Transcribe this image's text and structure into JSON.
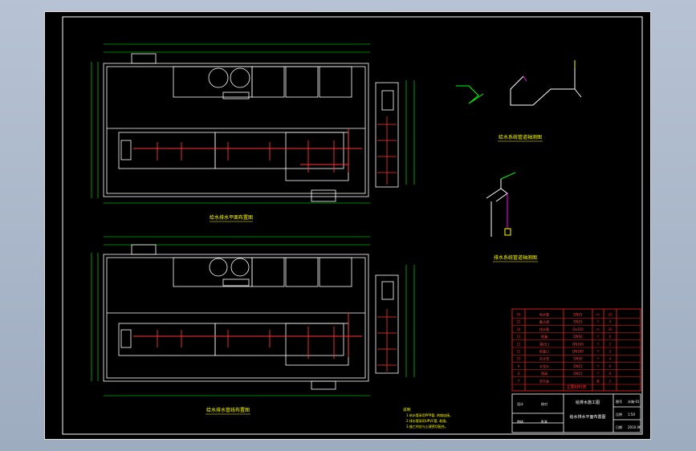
{
  "drawing": {
    "plan_top_title": "给水排水平面布置图",
    "plan_bottom_title": "给水排水管线布置图",
    "iso_supply_title": "给水系统管道轴测图",
    "iso_drain_title": "排水系统管道轴测图",
    "notes_heading": "说明:",
    "notes": [
      "1.给水管采用PPR管, 热熔连接。",
      "2.排水管采用UPVC管, 粘接。",
      "3.施工时应与土建密切配合。"
    ]
  },
  "legend_table": {
    "rows": [
      {
        "no": "16",
        "name": "给水管",
        "spec": "DN25",
        "unit": "m",
        "qty": "25"
      },
      {
        "no": "15",
        "name": "截止阀",
        "spec": "DN25",
        "unit": "个",
        "qty": "4"
      },
      {
        "no": "14",
        "name": "排水管",
        "spec": "De110",
        "unit": "m",
        "qty": "30"
      },
      {
        "no": "13",
        "name": "地漏",
        "spec": "DN50",
        "unit": "个",
        "qty": "6"
      },
      {
        "no": "12",
        "name": "清扫口",
        "spec": "DN100",
        "unit": "个",
        "qty": "2"
      },
      {
        "no": "11",
        "name": "检查口",
        "spec": "DN100",
        "unit": "个",
        "qty": "2"
      },
      {
        "no": "10",
        "name": "存水弯",
        "spec": "DN50",
        "unit": "个",
        "qty": "4"
      },
      {
        "no": "9",
        "name": "水龙头",
        "spec": "DN15",
        "unit": "个",
        "qty": "6"
      },
      {
        "no": "8",
        "name": "角阀",
        "spec": "DN15",
        "unit": "个",
        "qty": "8"
      },
      {
        "no": "7",
        "name": "洗手盆",
        "spec": "-",
        "unit": "套",
        "qty": "2"
      }
    ],
    "header": [
      "序号",
      "名称",
      "规格",
      "单位",
      "数量",
      "备注"
    ],
    "title": "主要材料表"
  },
  "title_block": {
    "project": "给排水施工图",
    "drawing_name": "给水排水平面布置图",
    "labels": [
      "设计",
      "校对",
      "审核",
      "批准"
    ],
    "fields": [
      "图号",
      "比例",
      "日期"
    ],
    "values": [
      "水施-01",
      "1:50",
      "2010.06"
    ]
  },
  "colors": {
    "background": "#000000",
    "wall": "#ffffff",
    "dimension": "#00ff00",
    "pipe_supply": "#ff3333",
    "pipe_drain": "#ff00ff",
    "text": "#00ff00",
    "annotation": "#ffff00",
    "table": "#ff2222"
  }
}
